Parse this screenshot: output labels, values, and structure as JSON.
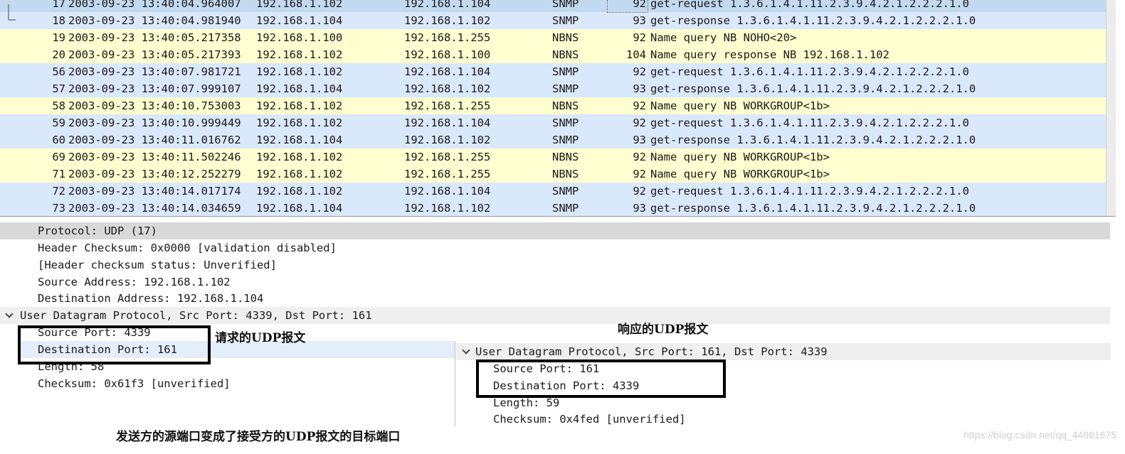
{
  "packets": [
    {
      "no": "17",
      "time": "2003-09-23 13:40:04.964007",
      "src": "192.168.1.102",
      "dst": "192.168.1.104",
      "proto": "SNMP",
      "len": "92",
      "info": "get-request 1.3.6.1.4.1.11.2.3.9.4.2.1.2.2.2.1.0",
      "type": "sel"
    },
    {
      "no": "18",
      "time": "2003-09-23 13:40:04.981940",
      "src": "192.168.1.104",
      "dst": "192.168.1.102",
      "proto": "SNMP",
      "len": "93",
      "info": "get-response 1.3.6.1.4.1.11.2.3.9.4.2.1.2.2.2.1.0",
      "type": "snmp"
    },
    {
      "no": "19",
      "time": "2003-09-23 13:40:05.217358",
      "src": "192.168.1.100",
      "dst": "192.168.1.255",
      "proto": "NBNS",
      "len": "92",
      "info": "Name query NB NOHO<20>",
      "type": "nbns"
    },
    {
      "no": "20",
      "time": "2003-09-23 13:40:05.217393",
      "src": "192.168.1.102",
      "dst": "192.168.1.100",
      "proto": "NBNS",
      "len": "104",
      "info": "Name query response NB 192.168.1.102",
      "type": "nbns"
    },
    {
      "no": "56",
      "time": "2003-09-23 13:40:07.981721",
      "src": "192.168.1.102",
      "dst": "192.168.1.104",
      "proto": "SNMP",
      "len": "92",
      "info": "get-request 1.3.6.1.4.1.11.2.3.9.4.2.1.2.2.2.1.0",
      "type": "snmp"
    },
    {
      "no": "57",
      "time": "2003-09-23 13:40:07.999107",
      "src": "192.168.1.104",
      "dst": "192.168.1.102",
      "proto": "SNMP",
      "len": "93",
      "info": "get-response 1.3.6.1.4.1.11.2.3.9.4.2.1.2.2.2.1.0",
      "type": "snmp"
    },
    {
      "no": "58",
      "time": "2003-09-23 13:40:10.753003",
      "src": "192.168.1.102",
      "dst": "192.168.1.255",
      "proto": "NBNS",
      "len": "92",
      "info": "Name query NB WORKGROUP<1b>",
      "type": "nbns"
    },
    {
      "no": "59",
      "time": "2003-09-23 13:40:10.999449",
      "src": "192.168.1.102",
      "dst": "192.168.1.104",
      "proto": "SNMP",
      "len": "92",
      "info": "get-request 1.3.6.1.4.1.11.2.3.9.4.2.1.2.2.2.1.0",
      "type": "snmp"
    },
    {
      "no": "60",
      "time": "2003-09-23 13:40:11.016762",
      "src": "192.168.1.104",
      "dst": "192.168.1.102",
      "proto": "SNMP",
      "len": "93",
      "info": "get-response 1.3.6.1.4.1.11.2.3.9.4.2.1.2.2.2.1.0",
      "type": "snmp"
    },
    {
      "no": "69",
      "time": "2003-09-23 13:40:11.502246",
      "src": "192.168.1.102",
      "dst": "192.168.1.255",
      "proto": "NBNS",
      "len": "92",
      "info": "Name query NB WORKGROUP<1b>",
      "type": "nbns"
    },
    {
      "no": "71",
      "time": "2003-09-23 13:40:12.252279",
      "src": "192.168.1.102",
      "dst": "192.168.1.255",
      "proto": "NBNS",
      "len": "92",
      "info": "Name query NB WORKGROUP<1b>",
      "type": "nbns"
    },
    {
      "no": "72",
      "time": "2003-09-23 13:40:14.017174",
      "src": "192.168.1.102",
      "dst": "192.168.1.104",
      "proto": "SNMP",
      "len": "92",
      "info": "get-request 1.3.6.1.4.1.11.2.3.9.4.2.1.2.2.2.1.0",
      "type": "snmp"
    },
    {
      "no": "73",
      "time": "2003-09-23 13:40:14.034659",
      "src": "192.168.1.104",
      "dst": "192.168.1.102",
      "proto": "SNMP",
      "len": "93",
      "info": "get-response 1.3.6.1.4.1.11.2.3.9.4.2.1.2.2.2.1.0",
      "type": "snmp"
    }
  ],
  "details": {
    "protocol": "Protocol: UDP (17)",
    "header_checksum": "Header Checksum: 0x0000 [validation disabled]",
    "header_checksum_status": "[Header checksum status: Unverified]",
    "source_address": "Source Address: 192.168.1.102",
    "destination_address": "Destination Address: 192.168.1.104",
    "udp_header": "User Datagram Protocol, Src Port: 4339, Dst Port: 161",
    "source_port": "Source Port: 4339",
    "destination_port": "Destination Port: 161",
    "length": "Length: 58",
    "checksum": "Checksum: 0x61f3 [unverified]"
  },
  "response_details": {
    "udp_header": "User Datagram Protocol, Src Port: 161, Dst Port: 4339",
    "source_port": "Source Port: 161",
    "destination_port": "Destination Port: 4339",
    "length": "Length: 59",
    "checksum": "Checksum: 0x4fed [unverified]"
  },
  "annotations": {
    "request_label": "请求的UDP报文",
    "response_label": "响应的UDP报文",
    "bottom_note": "发送方的源端口变成了接受方的UDP报文的目标端口"
  },
  "watermark": "https://blog.csdn.net/qq_44861675",
  "colors": {
    "snmp_row": "#dae8fc",
    "nbns_row": "#fefed0",
    "selected_row": "#c3d9ef"
  }
}
